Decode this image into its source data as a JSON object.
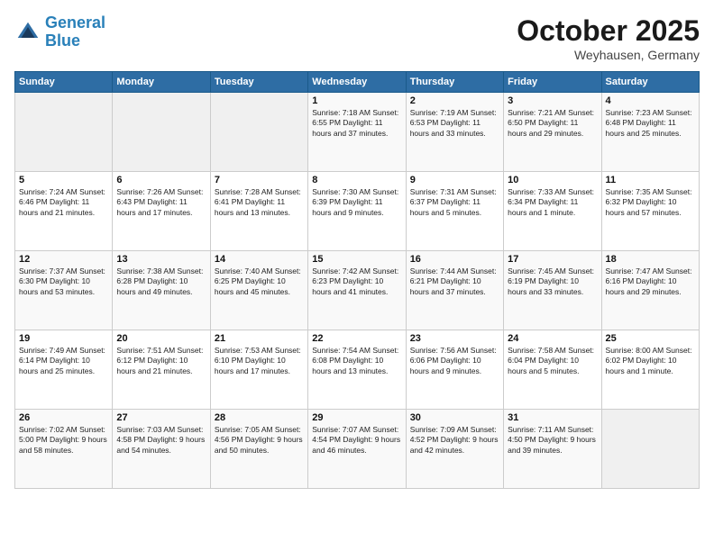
{
  "header": {
    "logo_line1": "General",
    "logo_line2": "Blue",
    "month": "October 2025",
    "location": "Weyhausen, Germany"
  },
  "weekdays": [
    "Sunday",
    "Monday",
    "Tuesday",
    "Wednesday",
    "Thursday",
    "Friday",
    "Saturday"
  ],
  "weeks": [
    [
      {
        "day": "",
        "info": ""
      },
      {
        "day": "",
        "info": ""
      },
      {
        "day": "",
        "info": ""
      },
      {
        "day": "1",
        "info": "Sunrise: 7:18 AM\nSunset: 6:55 PM\nDaylight: 11 hours\nand 37 minutes."
      },
      {
        "day": "2",
        "info": "Sunrise: 7:19 AM\nSunset: 6:53 PM\nDaylight: 11 hours\nand 33 minutes."
      },
      {
        "day": "3",
        "info": "Sunrise: 7:21 AM\nSunset: 6:50 PM\nDaylight: 11 hours\nand 29 minutes."
      },
      {
        "day": "4",
        "info": "Sunrise: 7:23 AM\nSunset: 6:48 PM\nDaylight: 11 hours\nand 25 minutes."
      }
    ],
    [
      {
        "day": "5",
        "info": "Sunrise: 7:24 AM\nSunset: 6:46 PM\nDaylight: 11 hours\nand 21 minutes."
      },
      {
        "day": "6",
        "info": "Sunrise: 7:26 AM\nSunset: 6:43 PM\nDaylight: 11 hours\nand 17 minutes."
      },
      {
        "day": "7",
        "info": "Sunrise: 7:28 AM\nSunset: 6:41 PM\nDaylight: 11 hours\nand 13 minutes."
      },
      {
        "day": "8",
        "info": "Sunrise: 7:30 AM\nSunset: 6:39 PM\nDaylight: 11 hours\nand 9 minutes."
      },
      {
        "day": "9",
        "info": "Sunrise: 7:31 AM\nSunset: 6:37 PM\nDaylight: 11 hours\nand 5 minutes."
      },
      {
        "day": "10",
        "info": "Sunrise: 7:33 AM\nSunset: 6:34 PM\nDaylight: 11 hours\nand 1 minute."
      },
      {
        "day": "11",
        "info": "Sunrise: 7:35 AM\nSunset: 6:32 PM\nDaylight: 10 hours\nand 57 minutes."
      }
    ],
    [
      {
        "day": "12",
        "info": "Sunrise: 7:37 AM\nSunset: 6:30 PM\nDaylight: 10 hours\nand 53 minutes."
      },
      {
        "day": "13",
        "info": "Sunrise: 7:38 AM\nSunset: 6:28 PM\nDaylight: 10 hours\nand 49 minutes."
      },
      {
        "day": "14",
        "info": "Sunrise: 7:40 AM\nSunset: 6:25 PM\nDaylight: 10 hours\nand 45 minutes."
      },
      {
        "day": "15",
        "info": "Sunrise: 7:42 AM\nSunset: 6:23 PM\nDaylight: 10 hours\nand 41 minutes."
      },
      {
        "day": "16",
        "info": "Sunrise: 7:44 AM\nSunset: 6:21 PM\nDaylight: 10 hours\nand 37 minutes."
      },
      {
        "day": "17",
        "info": "Sunrise: 7:45 AM\nSunset: 6:19 PM\nDaylight: 10 hours\nand 33 minutes."
      },
      {
        "day": "18",
        "info": "Sunrise: 7:47 AM\nSunset: 6:16 PM\nDaylight: 10 hours\nand 29 minutes."
      }
    ],
    [
      {
        "day": "19",
        "info": "Sunrise: 7:49 AM\nSunset: 6:14 PM\nDaylight: 10 hours\nand 25 minutes."
      },
      {
        "day": "20",
        "info": "Sunrise: 7:51 AM\nSunset: 6:12 PM\nDaylight: 10 hours\nand 21 minutes."
      },
      {
        "day": "21",
        "info": "Sunrise: 7:53 AM\nSunset: 6:10 PM\nDaylight: 10 hours\nand 17 minutes."
      },
      {
        "day": "22",
        "info": "Sunrise: 7:54 AM\nSunset: 6:08 PM\nDaylight: 10 hours\nand 13 minutes."
      },
      {
        "day": "23",
        "info": "Sunrise: 7:56 AM\nSunset: 6:06 PM\nDaylight: 10 hours\nand 9 minutes."
      },
      {
        "day": "24",
        "info": "Sunrise: 7:58 AM\nSunset: 6:04 PM\nDaylight: 10 hours\nand 5 minutes."
      },
      {
        "day": "25",
        "info": "Sunrise: 8:00 AM\nSunset: 6:02 PM\nDaylight: 10 hours\nand 1 minute."
      }
    ],
    [
      {
        "day": "26",
        "info": "Sunrise: 7:02 AM\nSunset: 5:00 PM\nDaylight: 9 hours\nand 58 minutes."
      },
      {
        "day": "27",
        "info": "Sunrise: 7:03 AM\nSunset: 4:58 PM\nDaylight: 9 hours\nand 54 minutes."
      },
      {
        "day": "28",
        "info": "Sunrise: 7:05 AM\nSunset: 4:56 PM\nDaylight: 9 hours\nand 50 minutes."
      },
      {
        "day": "29",
        "info": "Sunrise: 7:07 AM\nSunset: 4:54 PM\nDaylight: 9 hours\nand 46 minutes."
      },
      {
        "day": "30",
        "info": "Sunrise: 7:09 AM\nSunset: 4:52 PM\nDaylight: 9 hours\nand 42 minutes."
      },
      {
        "day": "31",
        "info": "Sunrise: 7:11 AM\nSunset: 4:50 PM\nDaylight: 9 hours\nand 39 minutes."
      },
      {
        "day": "",
        "info": ""
      }
    ]
  ]
}
